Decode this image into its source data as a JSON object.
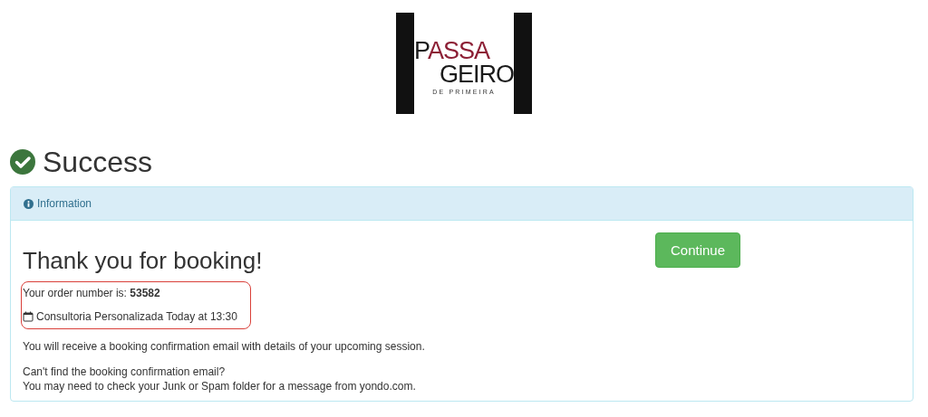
{
  "logo": {
    "lines": [
      [
        {
          "text": "P",
          "color": "#1a1a1a"
        },
        {
          "text": "ASSA",
          "color": "#8c1f35"
        }
      ],
      [
        {
          "text": "GEIRO",
          "color": "#1a1a1a"
        }
      ]
    ],
    "tagline": "DE PRIMEIRA"
  },
  "heading": "Success",
  "panel": {
    "header": "Information",
    "title": "Thank you for booking!",
    "order_label": "Your order number is:",
    "order_number": "53582",
    "session": "Consultoria Personalizada Today at 13:30",
    "note": "You will receive a booking confirmation email with details of your upcoming session.",
    "help_lines": [
      "Can't find the booking confirmation email?",
      "You may need to check your Junk or Spam folder for a message from yondo.com."
    ],
    "button": "Continue"
  }
}
